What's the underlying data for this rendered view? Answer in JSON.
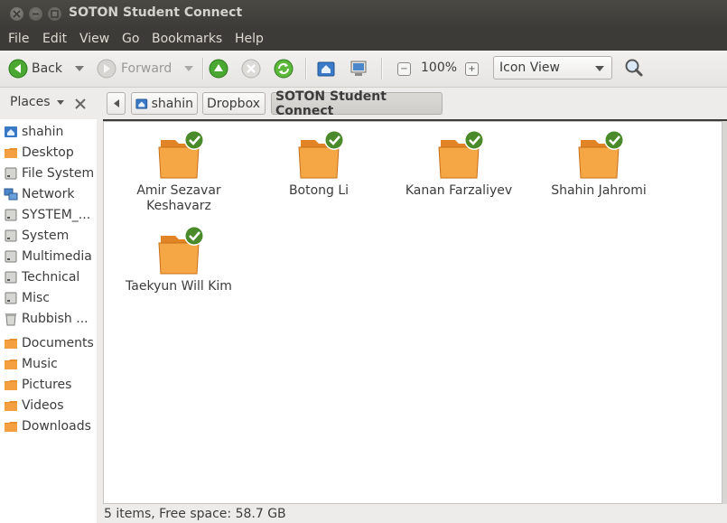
{
  "window": {
    "title": "SOTON Student Connect"
  },
  "menubar": [
    "File",
    "Edit",
    "View",
    "Go",
    "Bookmarks",
    "Help"
  ],
  "toolbar": {
    "back_label": "Back",
    "forward_label": "Forward",
    "zoom_level": "100%",
    "view_mode": "Icon View"
  },
  "places": {
    "header": "Places"
  },
  "breadcrumb": [
    "shahin",
    "Dropbox",
    "SOTON Student Connect"
  ],
  "sidebar": {
    "items": [
      {
        "label": "shahin",
        "icon": "home-icon"
      },
      {
        "label": "Desktop",
        "icon": "desktop-folder-icon"
      },
      {
        "label": "File System",
        "icon": "drive-icon"
      },
      {
        "label": "Network",
        "icon": "network-icon"
      },
      {
        "label": "SYSTEM_...",
        "icon": "drive-icon"
      },
      {
        "label": "System",
        "icon": "drive-icon"
      },
      {
        "label": "Multimedia",
        "icon": "drive-icon"
      },
      {
        "label": "Technical",
        "icon": "drive-icon"
      },
      {
        "label": "Misc",
        "icon": "drive-icon"
      },
      {
        "label": "Rubbish ...",
        "icon": "trash-icon"
      },
      {
        "label": "Documents",
        "icon": "folder-icon"
      },
      {
        "label": "Music",
        "icon": "folder-icon"
      },
      {
        "label": "Pictures",
        "icon": "folder-icon"
      },
      {
        "label": "Videos",
        "icon": "folder-icon"
      },
      {
        "label": "Downloads",
        "icon": "folder-icon"
      }
    ]
  },
  "files": [
    {
      "name_line1": "Amir Sezavar",
      "name_line2": "Keshavarz"
    },
    {
      "name_line1": "Botong Li",
      "name_line2": ""
    },
    {
      "name_line1": "Kanan Farzaliyev",
      "name_line2": ""
    },
    {
      "name_line1": "Shahin Jahromi",
      "name_line2": ""
    },
    {
      "name_line1": "Taekyun Will Kim",
      "name_line2": ""
    }
  ],
  "status": {
    "text": "5 items, Free space: 58.7 GB"
  },
  "colors": {
    "folder": "#f5a040",
    "sync_ok": "#4a8a2a",
    "accent": "#3c3b37"
  }
}
